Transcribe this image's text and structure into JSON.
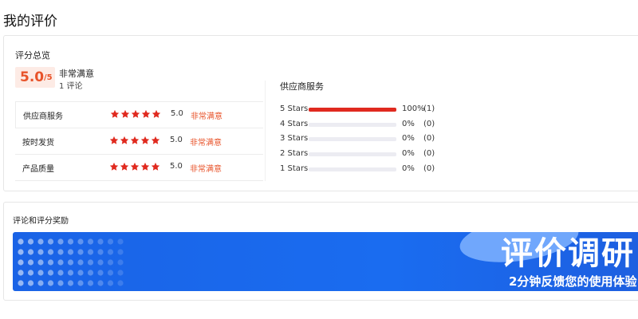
{
  "page": {
    "title": "我的评价"
  },
  "summary": {
    "title": "评分总览",
    "score": "5.0",
    "score_unit": "/5",
    "level": "非常满意",
    "review_count": "1 评论",
    "rows": [
      {
        "name": "供应商服务",
        "stars": 5,
        "score": "5.0",
        "level": "非常满意"
      },
      {
        "name": "按时发货",
        "stars": 5,
        "score": "5.0",
        "level": "非常满意"
      },
      {
        "name": "产品质量",
        "stars": 5,
        "score": "5.0",
        "level": "非常满意"
      }
    ],
    "star_color": "#e02a1f"
  },
  "distribution": {
    "title": "供应商服务",
    "rows": [
      {
        "label": "5 Stars",
        "fraction": 1.0,
        "percent": "100%",
        "count": "(1)"
      },
      {
        "label": "4 Stars",
        "fraction": 0.0,
        "percent": "0%",
        "count": "(0)"
      },
      {
        "label": "3 Stars",
        "fraction": 0.0,
        "percent": "0%",
        "count": "(0)"
      },
      {
        "label": "2 Stars",
        "fraction": 0.0,
        "percent": "0%",
        "count": "(0)"
      },
      {
        "label": "1 Stars",
        "fraction": 0.0,
        "percent": "0%",
        "count": "(0)"
      }
    ],
    "bar_color": "#e02a1f"
  },
  "rewards": {
    "title": "评论和评分奖励",
    "banner_title": "评价调研",
    "banner_subtitle": "2分钟反馈您的使用体验"
  }
}
